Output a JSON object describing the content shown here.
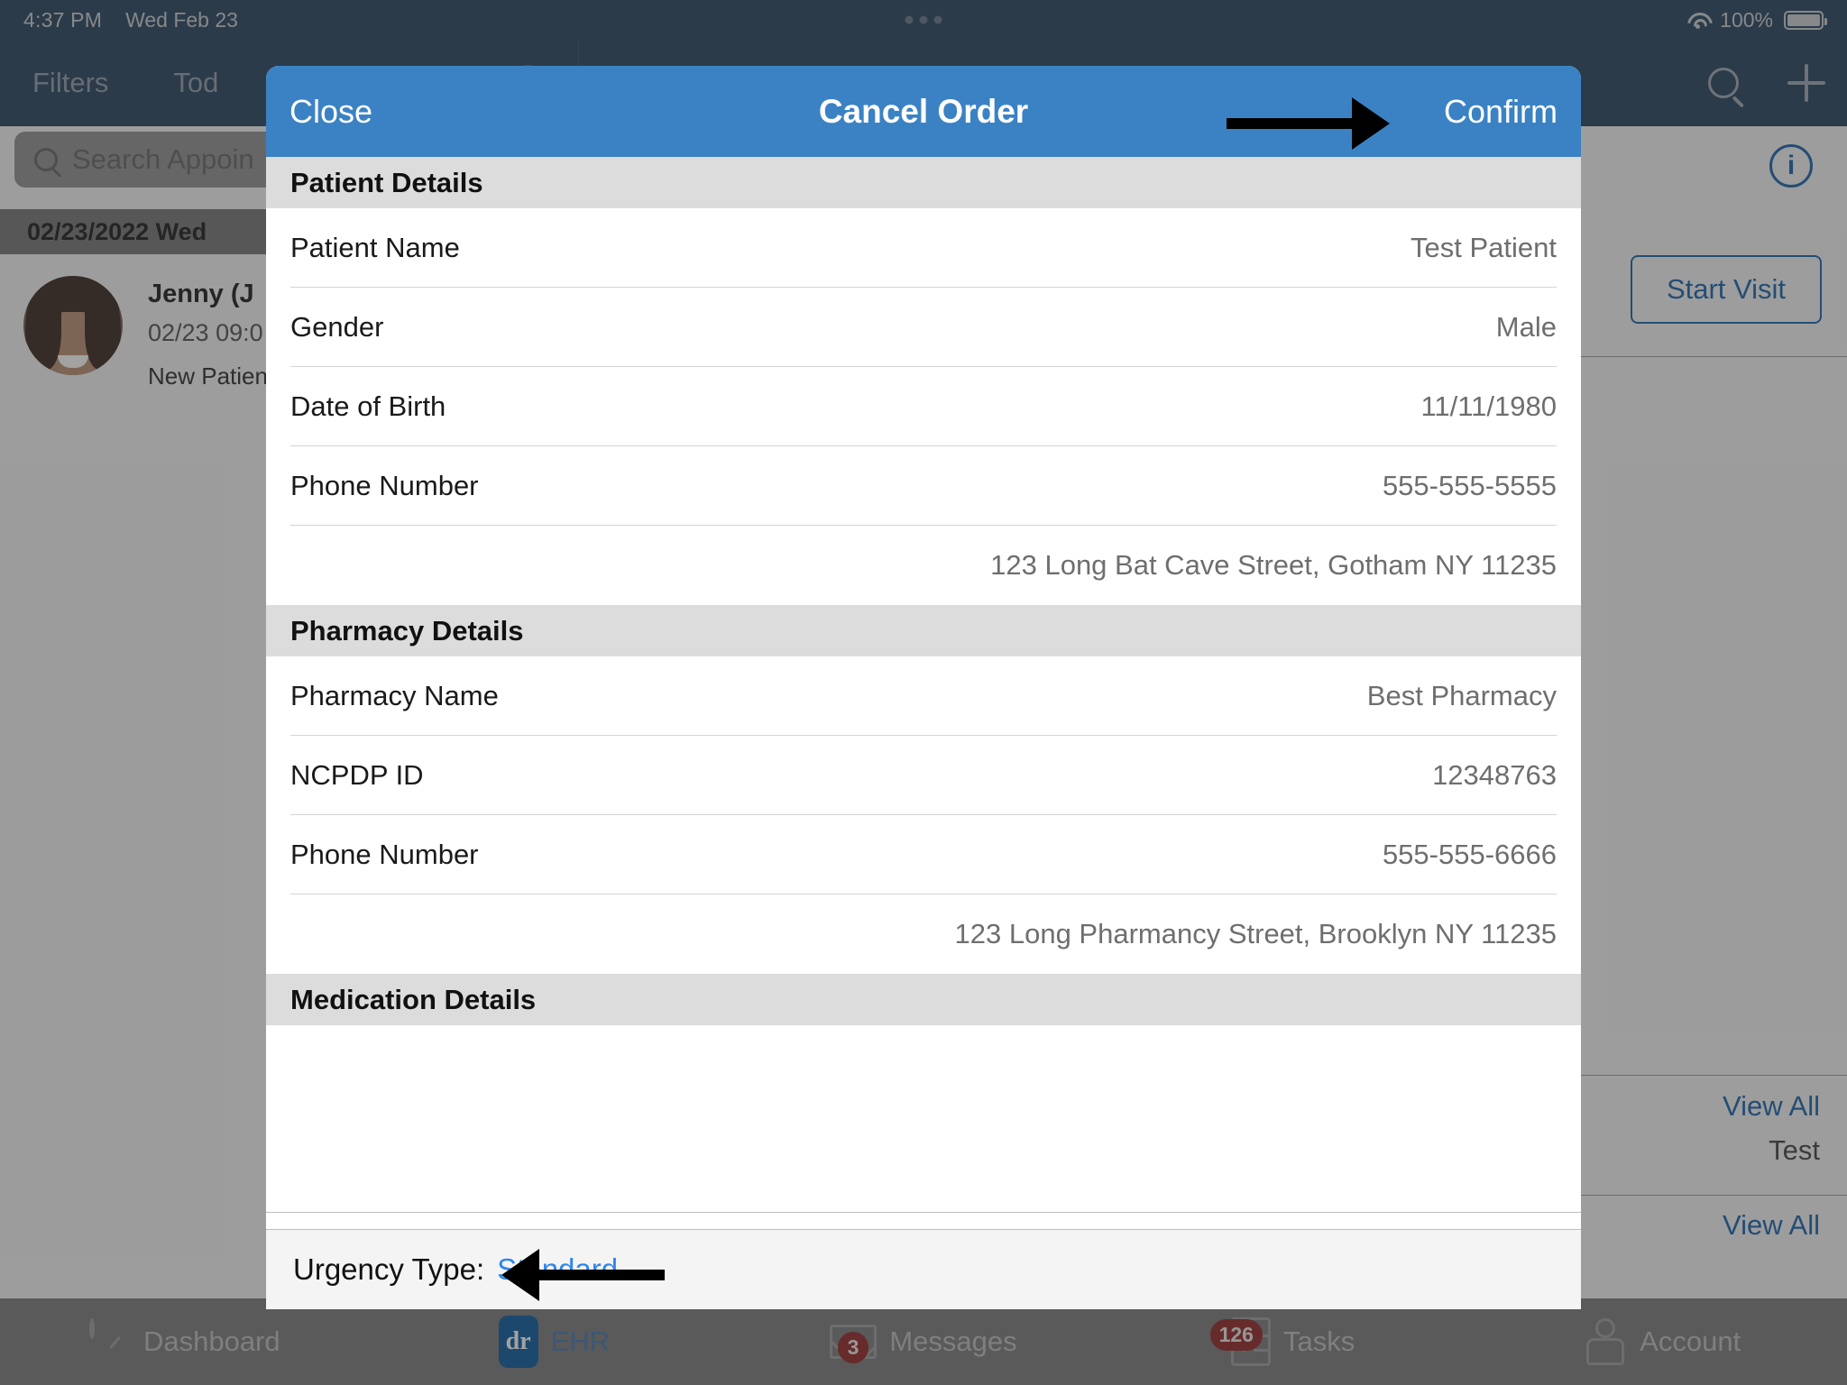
{
  "status_bar": {
    "time": "4:37 PM",
    "date": "Wed Feb 23",
    "battery_percent": "100%",
    "wifi_icon": "wifi-icon",
    "battery_icon": "battery-icon",
    "handle_icon": "multitask-handle-icon"
  },
  "navbar": {
    "filters_label": "Filters",
    "today_label": "Tod",
    "share_icon": "share-icon",
    "search_icon": "search-icon",
    "add_icon": "plus-icon"
  },
  "appointments": {
    "search_placeholder": "Search Appoin",
    "date_header": "02/23/2022 Wed ",
    "patient_name": "Jenny (J",
    "appointment_time": "02/23 09:0",
    "visit_type": "New Patien",
    "info_icon": "i",
    "start_visit_label": "Start Visit",
    "view_all_1": "View All",
    "test_label": "Test",
    "view_all_2": "View All"
  },
  "tabbar": {
    "items": [
      {
        "label": "Dashboard",
        "icon": "dashboard-gauge-icon",
        "badge": ""
      },
      {
        "label": "EHR",
        "icon": "ehr-dr-icon",
        "badge": ""
      },
      {
        "label": "Messages",
        "icon": "envelope-icon",
        "badge": "3"
      },
      {
        "label": "Tasks",
        "icon": "checklist-icon",
        "badge": "126"
      },
      {
        "label": "Account",
        "icon": "doctor-avatar-icon",
        "badge": ""
      }
    ]
  },
  "modal": {
    "close_label": "Close",
    "title": "Cancel Order",
    "confirm_label": "Confirm",
    "sections": {
      "patient": {
        "header": "Patient Details",
        "rows": [
          {
            "key": "Patient Name",
            "value": "Test Patient"
          },
          {
            "key": "Gender",
            "value": "Male"
          },
          {
            "key": "Date of Birth",
            "value": "11/11/1980"
          },
          {
            "key": "Phone Number",
            "value": "555-555-5555"
          }
        ],
        "address": "123 Long Bat Cave Street, Gotham NY 11235"
      },
      "pharmacy": {
        "header": "Pharmacy Details",
        "rows": [
          {
            "key": "Pharmacy Name",
            "value": "Best Pharmacy"
          },
          {
            "key": "NCPDP ID",
            "value": "12348763"
          },
          {
            "key": "Phone Number",
            "value": "555-555-6666"
          }
        ],
        "address": "123 Long Pharmancy Street, Brooklyn NY 11235"
      },
      "medication": {
        "header": "Medication Details"
      }
    },
    "footer": {
      "urgency_label": "Urgency Type:",
      "urgency_value": "Standard"
    }
  },
  "annotations": {
    "arrow_confirm": "arrow-pointing-right-to-confirm",
    "arrow_urgency": "arrow-pointing-left-to-urgency-type"
  },
  "colors": {
    "nav_blue": "#1b3a57",
    "modal_header_blue": "#3b82c4",
    "link_blue": "#2f86f0",
    "accent_blue": "#0f5ca8",
    "badge_red": "#8e1b1b",
    "section_gray": "#dcdcdc"
  }
}
